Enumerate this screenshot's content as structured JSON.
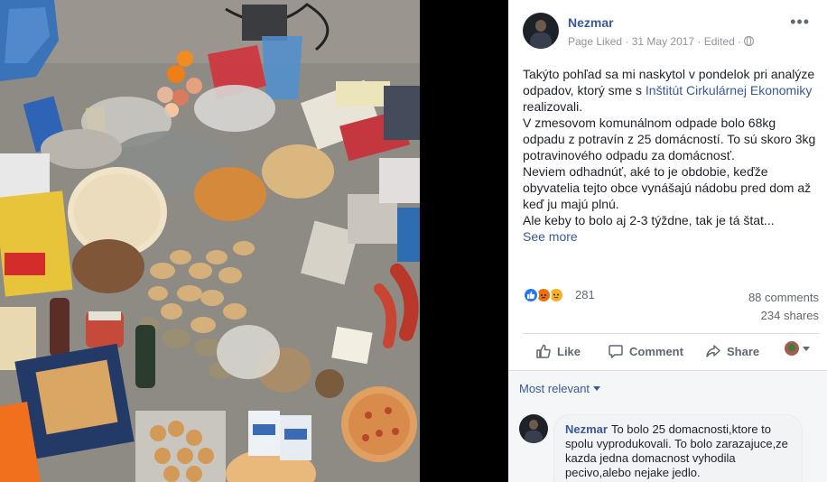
{
  "post": {
    "author": "Nezmar",
    "meta": "Page Liked · 31 May 2017 · Edited ·",
    "more": "•••",
    "text": {
      "line1": "Takýto pohľad sa mi naskytol v pondelok pri analýze odpadov, ktorý sme s ",
      "link": "Inštitút Cirkulárnej Ekonomiky",
      "line1_end": " realizovali.",
      "line2": "V zmesovom komunálnom odpade bolo 68kg odpadu z potravín z 25 domácností. To sú skoro 3kg potravinového odpadu za domácnosť.",
      "line3": "Neviem odhadnúť, aké to je obdobie, keďže obyvatelia tejto obce vynášajú nádobu pred dom až keď ju majú plnú.",
      "line4": "Ale keby to bolo aj 2-3 týždne, tak je tá štat...",
      "see_more": "See more"
    },
    "reactions": {
      "count": "281",
      "comments": "88 comments",
      "shares": "234 shares"
    },
    "actions": {
      "like": "Like",
      "comment": "Comment",
      "share": "Share"
    }
  },
  "comments": {
    "sort_label": "Most relevant",
    "items": [
      {
        "author": "Nezmar",
        "text": "To bolo 25 domacnosti,ktore to spolu vyprodukovali. To bolo zarazajuce,ze kazda jedna domacnost vyhodila pecivo,alebo nejake jedlo."
      }
    ]
  },
  "colors": {
    "link": "#385898",
    "like_reaction": "#2078f4",
    "angry_reaction": "#e9710f",
    "sad_reaction": "#f7b125"
  },
  "icons": {
    "more": "more-options-icon",
    "globe": "globe-icon",
    "like": "thumbs-up-icon",
    "comment": "comment-bubble-icon",
    "share": "share-arrow-icon",
    "reactions": [
      "like-reaction-icon",
      "angry-reaction-icon",
      "sad-reaction-icon"
    ]
  }
}
